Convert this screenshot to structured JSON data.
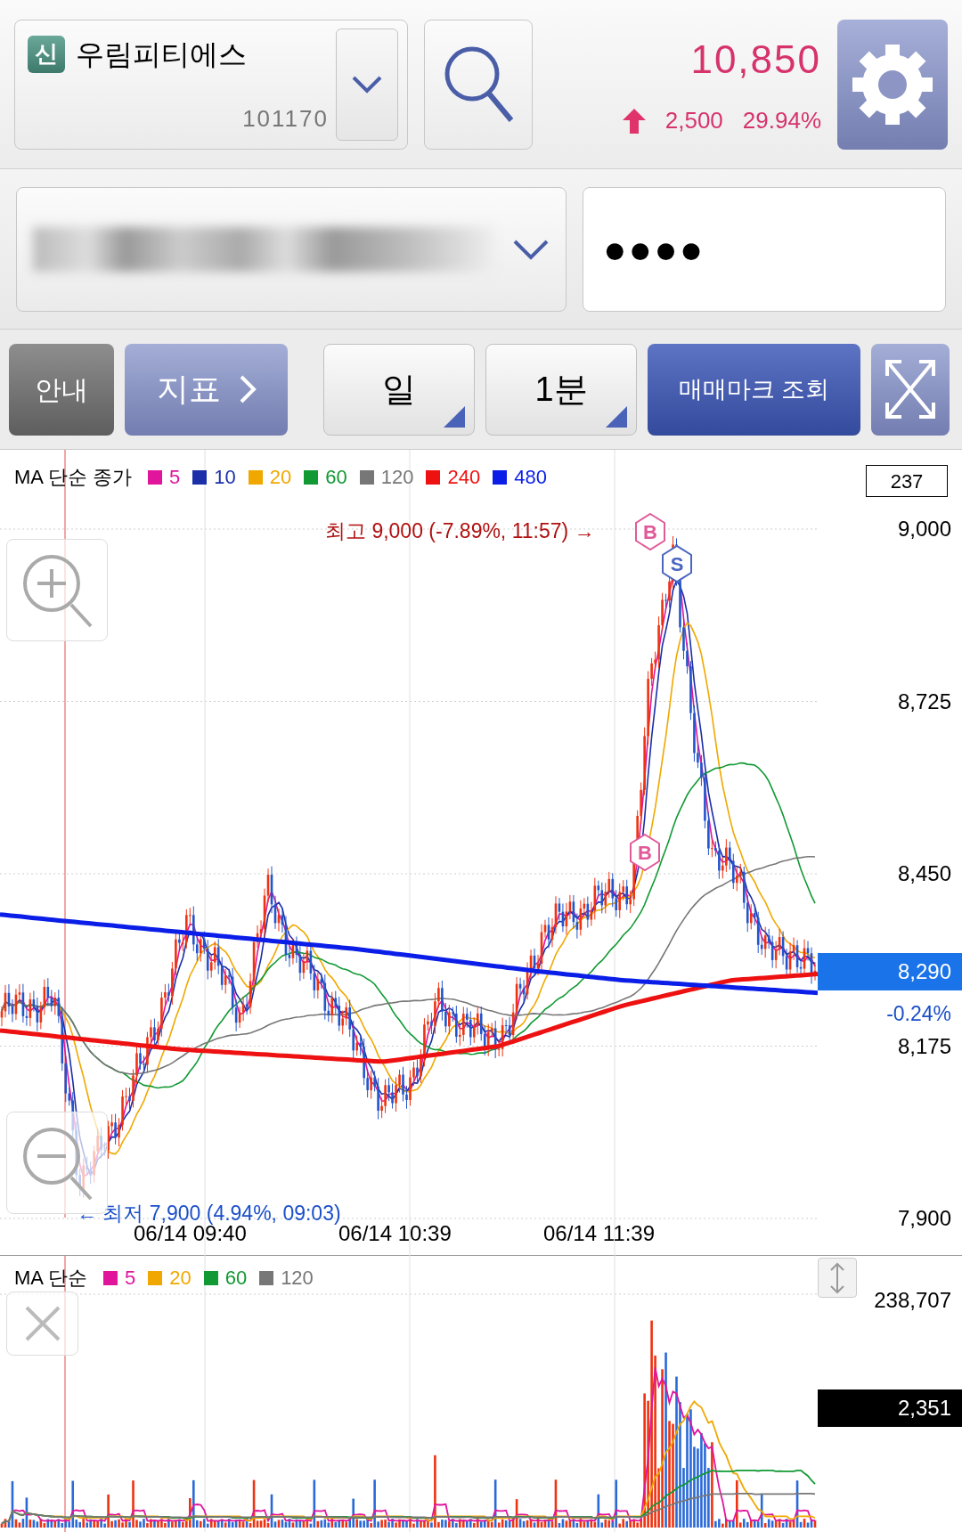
{
  "stock": {
    "badge": "신",
    "name": "우림피티에스",
    "code": "101170"
  },
  "quote": {
    "price": "10,850",
    "change": "2,500",
    "change_rate": "29.94%"
  },
  "password": {
    "value": "●●●●"
  },
  "toolbar": [
    {
      "label": "안내",
      "kind": "dark"
    },
    {
      "label": "지표",
      "kind": "menu"
    },
    {
      "label": "일",
      "kind": "select"
    },
    {
      "label": "1분",
      "kind": "select"
    },
    {
      "label": "매매마크 조회",
      "kind": "primary"
    }
  ],
  "price_chart": {
    "legend_title": "MA 단순 종가",
    "legend": [
      {
        "label": "5",
        "color": "#e0159c"
      },
      {
        "label": "10",
        "color": "#1a2fa8"
      },
      {
        "label": "20",
        "color": "#f0a800"
      },
      {
        "label": "60",
        "color": "#119933"
      },
      {
        "label": "120",
        "color": "#777777"
      },
      {
        "label": "240",
        "color": "#ee1111"
      },
      {
        "label": "480",
        "color": "#0a1ee8"
      }
    ],
    "count": "237",
    "y_labels": [
      "9,000",
      "8,725",
      "8,450",
      "8,175",
      "7,900"
    ],
    "x_labels": [
      "06/14 09:40",
      "06/14 10:39",
      "06/14 11:39"
    ],
    "high_note": "최고 9,000 (-7.89%, 11:57) →",
    "low_note": "← 최저 7,900 (4.94%, 09:03)",
    "current_price": "8,290",
    "current_change": "-0.24%",
    "marks": [
      {
        "kind": "buy",
        "label": "B"
      },
      {
        "kind": "sell",
        "label": "S"
      },
      {
        "kind": "buy",
        "label": "B"
      }
    ]
  },
  "volume_chart": {
    "legend_title": "MA 단순",
    "legend": [
      {
        "label": "5",
        "color": "#e0159c"
      },
      {
        "label": "20",
        "color": "#f0a800"
      },
      {
        "label": "60",
        "color": "#119933"
      },
      {
        "label": "120",
        "color": "#777777"
      }
    ],
    "max_label": "238,707",
    "current_volume": "2,351"
  }
}
